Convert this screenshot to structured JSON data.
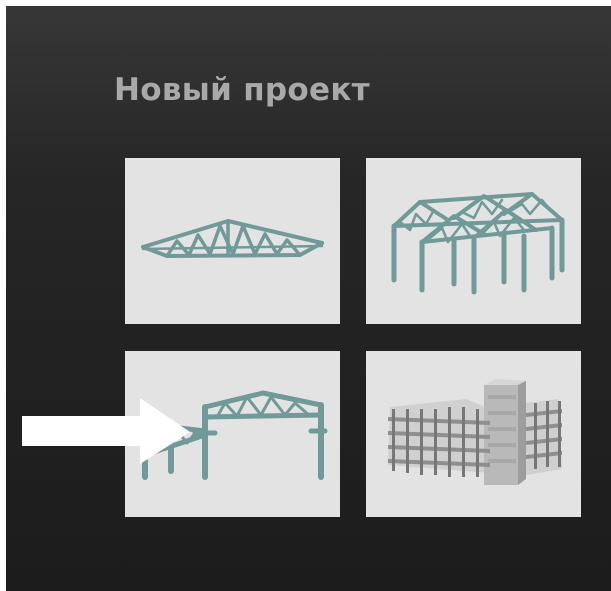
{
  "dialog": {
    "title": "Новый проект"
  },
  "templates": [
    {
      "id": "truss",
      "icon": "roof-truss-icon"
    },
    {
      "id": "frame-building",
      "icon": "steel-frame-building-icon"
    },
    {
      "id": "industrial-hall",
      "icon": "portal-frame-hall-icon"
    },
    {
      "id": "multistory-building",
      "icon": "multistory-building-icon"
    }
  ],
  "annotation": {
    "icon": "right-arrow-icon",
    "points_to": "industrial-hall",
    "color": "#ffffff"
  },
  "colors": {
    "background": "#1e1e1e",
    "title": "#a9a9a9",
    "tile": "#e3e3e3",
    "steel": "#6f9a98",
    "concrete": "#bdbdbd"
  }
}
